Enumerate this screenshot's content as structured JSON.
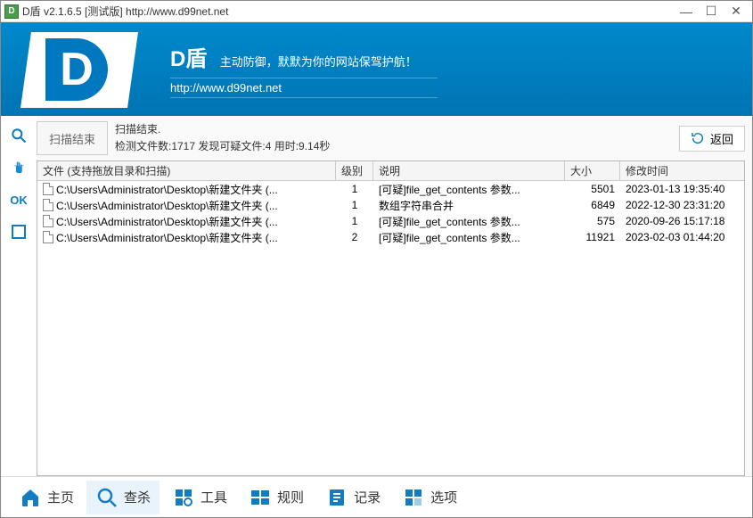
{
  "window": {
    "title": "D盾 v2.1.6.5 [测试版] http://www.d99net.net"
  },
  "banner": {
    "title": "D盾",
    "slogan": "主动防御，默默为你的网站保驾护航！",
    "url": "http://www.d99net.net"
  },
  "side": {
    "ok": "OK"
  },
  "status": {
    "scan_end_btn": "扫描结束",
    "line1": "扫描结束.",
    "line2": "检测文件数:1717 发现可疑文件:4 用时:9.14秒",
    "back": "返回"
  },
  "columns": {
    "file": "文件 (支持拖放目录和扫描)",
    "level": "级别",
    "desc": "说明",
    "size": "大小",
    "time": "修改时间"
  },
  "rows": [
    {
      "file": "C:\\Users\\Administrator\\Desktop\\新建文件夹 (...",
      "level": "1",
      "desc": "[可疑]file_get_contents 参数...",
      "size": "5501",
      "time": "2023-01-13 19:35:40"
    },
    {
      "file": "C:\\Users\\Administrator\\Desktop\\新建文件夹 (...",
      "level": "1",
      "desc": "数组字符串合并",
      "size": "6849",
      "time": "2022-12-30 23:31:20"
    },
    {
      "file": "C:\\Users\\Administrator\\Desktop\\新建文件夹 (...",
      "level": "1",
      "desc": "[可疑]file_get_contents 参数...",
      "size": "575",
      "time": "2020-09-26 15:17:18"
    },
    {
      "file": "C:\\Users\\Administrator\\Desktop\\新建文件夹 (...",
      "level": "2",
      "desc": "[可疑]file_get_contents 参数...",
      "size": "11921",
      "time": "2023-02-03 01:44:20"
    }
  ],
  "nav": {
    "home": "主页",
    "scan": "查杀",
    "tools": "工具",
    "rules": "规则",
    "logs": "记录",
    "options": "选项"
  }
}
